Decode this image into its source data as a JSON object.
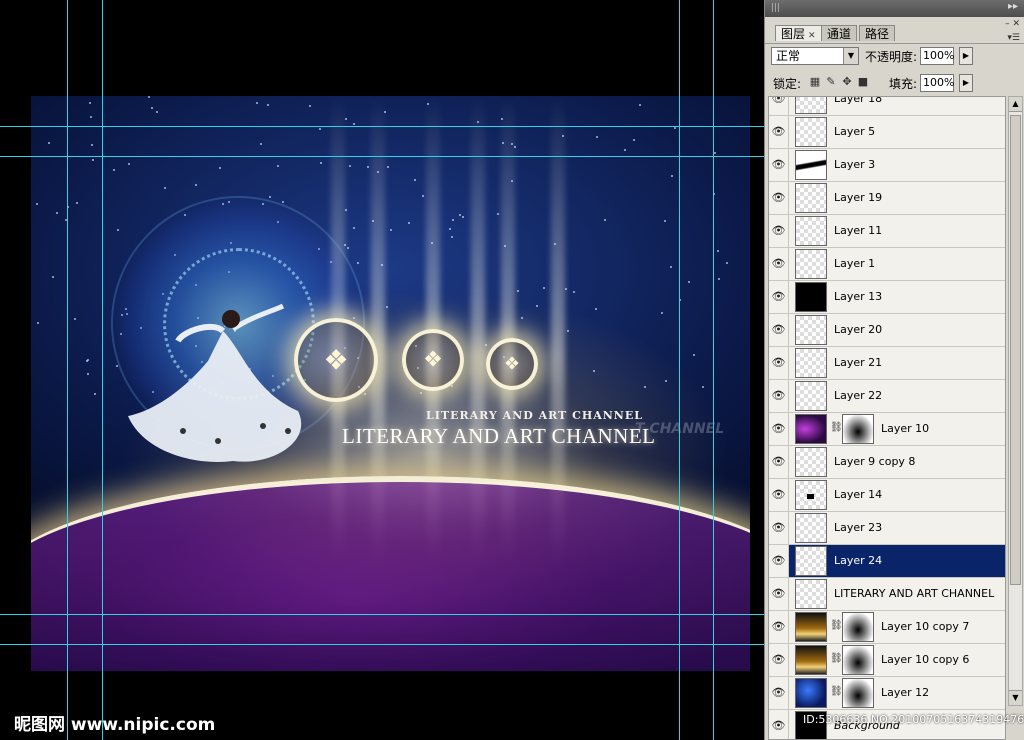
{
  "artwork": {
    "title_main": "LITERARY AND ART CHANNEL",
    "title_sub": "LITERARY AND ART CHANNEL",
    "title_echo": "T CHANNEL"
  },
  "watermark": {
    "brand": "昵图网 www.nipic.com",
    "id": "ID:5306636 NO:20100705163743194760"
  },
  "panel": {
    "tabs": [
      {
        "label": "图层",
        "active": true
      },
      {
        "label": "通道",
        "active": false
      },
      {
        "label": "路径",
        "active": false
      }
    ],
    "blend_mode": "正常",
    "opacity_label": "不透明度:",
    "opacity_value": "100%",
    "lock_label": "锁定:",
    "fill_label": "填充:",
    "fill_value": "100%",
    "layers": [
      {
        "name": "Layer 18"
      },
      {
        "name": "Layer 5"
      },
      {
        "name": "Layer 3"
      },
      {
        "name": "Layer 19"
      },
      {
        "name": "Layer 11"
      },
      {
        "name": "Layer 1"
      },
      {
        "name": "Layer 13"
      },
      {
        "name": "Layer 20"
      },
      {
        "name": "Layer 21"
      },
      {
        "name": "Layer 22"
      },
      {
        "name": "Layer 10"
      },
      {
        "name": "Layer 9 copy 8"
      },
      {
        "name": "Layer 14"
      },
      {
        "name": "Layer 23"
      },
      {
        "name": "Layer 24",
        "selected": true
      },
      {
        "name": "LITERARY AND ART CHANNEL"
      },
      {
        "name": "Layer 10 copy 7"
      },
      {
        "name": "Layer 10 copy 6"
      },
      {
        "name": "Layer 12"
      },
      {
        "name": "Background"
      }
    ]
  },
  "colors": {
    "guide": "#2fd3e6",
    "selection": "#0a246a"
  }
}
